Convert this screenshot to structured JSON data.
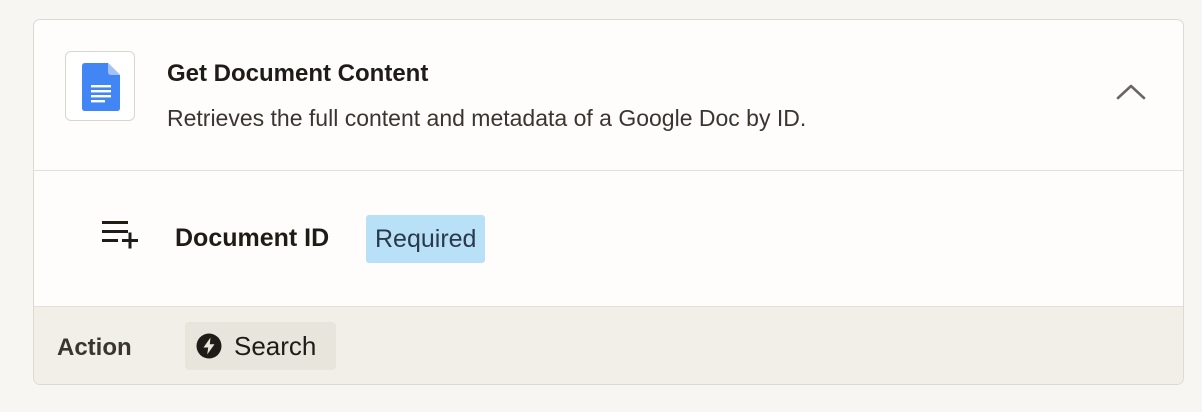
{
  "step": {
    "title": "Get Document Content",
    "description": "Retrieves the full content and metadata of a Google Doc by ID.",
    "app_icon": "google-docs-icon",
    "collapse_icon": "chevron-up-icon"
  },
  "field": {
    "icon": "add-to-list-icon",
    "label": "Document ID",
    "badge": "Required"
  },
  "footer": {
    "label": "Action",
    "type_icon": "bolt-icon",
    "type": "Search"
  },
  "colors": {
    "badge_bg": "#b8e0f7",
    "docs_blue": "#4285f4",
    "footer_bg": "#f2efe8"
  }
}
